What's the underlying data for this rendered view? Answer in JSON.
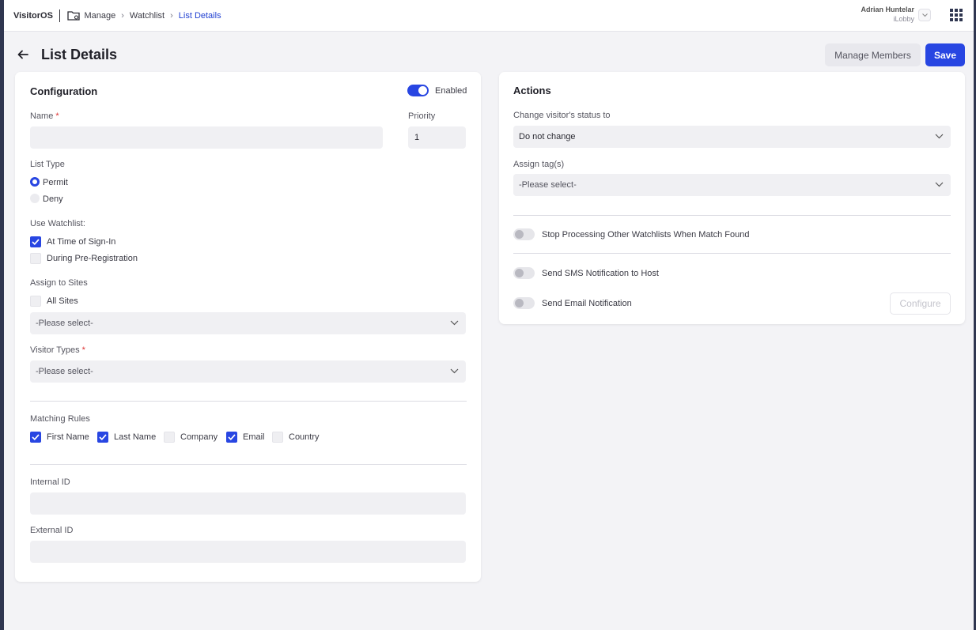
{
  "app": {
    "brand": "VisitorOS"
  },
  "breadcrumb": [
    "Manage",
    "Watchlist",
    "List Details"
  ],
  "user": {
    "name": "Adrian Huntelar",
    "org": "iLobby"
  },
  "page": {
    "title": "List Details",
    "manage_members_label": "Manage Members",
    "save_label": "Save"
  },
  "configuration": {
    "title": "Configuration",
    "enabled_label": "Enabled",
    "enabled": true,
    "name_label": "Name",
    "name_value": "",
    "priority_label": "Priority",
    "priority_value": "1",
    "list_type_label": "List Type",
    "list_type_options": [
      "Permit",
      "Deny"
    ],
    "list_type_selected": "Permit",
    "use_watchlist_label": "Use Watchlist:",
    "use_watchlist_options": [
      {
        "label": "At Time of Sign-In",
        "checked": true
      },
      {
        "label": "During Pre-Registration",
        "checked": false
      }
    ],
    "assign_sites_label": "Assign to Sites",
    "all_sites_label": "All Sites",
    "all_sites_checked": false,
    "sites_placeholder": "-Please select-",
    "visitor_types_label": "Visitor Types",
    "visitor_types_placeholder": "-Please select-",
    "matching_rules_label": "Matching Rules",
    "matching_rules": [
      {
        "label": "First Name",
        "checked": true
      },
      {
        "label": "Last Name",
        "checked": true
      },
      {
        "label": "Company",
        "checked": false
      },
      {
        "label": "Email",
        "checked": true
      },
      {
        "label": "Country",
        "checked": false
      }
    ],
    "internal_id_label": "Internal ID",
    "internal_id_value": "",
    "external_id_label": "External ID",
    "external_id_value": ""
  },
  "actions": {
    "title": "Actions",
    "change_status_label": "Change visitor's status to",
    "change_status_value": "Do not change",
    "assign_tags_label": "Assign tag(s)",
    "assign_tags_placeholder": "-Please select-",
    "stop_processing_label": "Stop Processing Other Watchlists When Match Found",
    "stop_processing_on": false,
    "sms_label": "Send SMS Notification to Host",
    "sms_on": false,
    "email_label": "Send Email Notification",
    "email_on": false,
    "configure_label": "Configure"
  },
  "icons": {
    "folder": "folder-settings-icon",
    "back": "arrow-left-icon",
    "apps": "apps-grid-icon",
    "chevron": "chevron-down-icon",
    "check": "check-icon"
  },
  "colors": {
    "accent": "#2846e2",
    "rail": "#2f3650",
    "required": "#d33333"
  }
}
